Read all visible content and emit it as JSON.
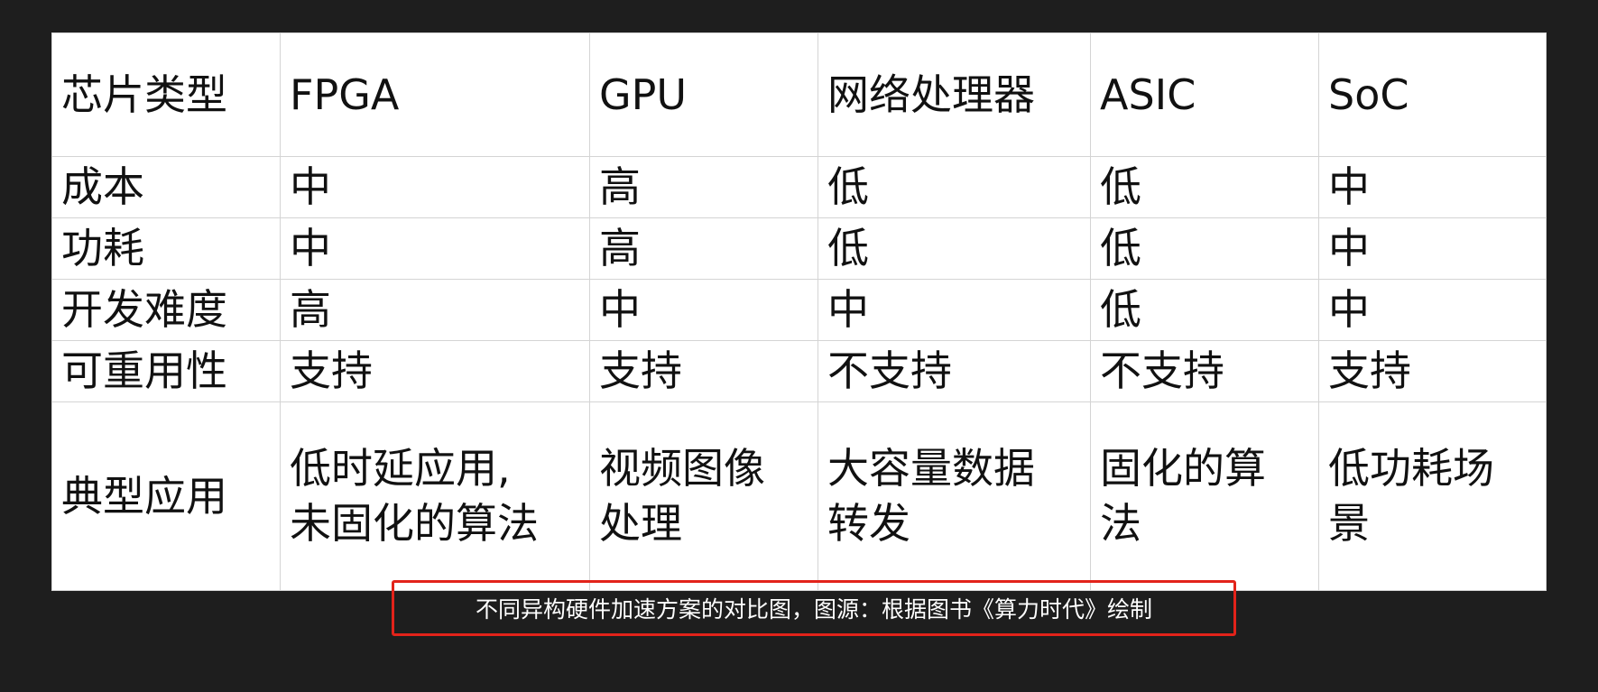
{
  "table": {
    "header": [
      "芯片类型",
      "FPGA",
      "GPU",
      "网络处理器",
      "ASIC",
      "SoC"
    ],
    "rows": [
      [
        "成本",
        "中",
        "高",
        "低",
        "低",
        "中"
      ],
      [
        "功耗",
        "中",
        "高",
        "低",
        "低",
        "中"
      ],
      [
        "开发难度",
        "高",
        "中",
        "中",
        "低",
        "中"
      ],
      [
        "可重用性",
        "支持",
        "支持",
        "不支持",
        "不支持",
        "支持"
      ]
    ],
    "apps_row": {
      "label": "典型应用",
      "cells": [
        [
          "低时延应用,",
          "未固化的算法"
        ],
        [
          "视频图像",
          "处理"
        ],
        [
          "大容量数据",
          "转发"
        ],
        [
          "固化的算",
          "法"
        ],
        [
          "低功耗场",
          "景"
        ]
      ]
    }
  },
  "caption": {
    "text": "不同异构硬件加速方案的对比图，图源：根据图书《算力时代》绘制"
  },
  "colors": {
    "background": "#1e1e1e",
    "table_bg": "#ffffff",
    "grid": "#d4d4d4",
    "highlight_box": "#e2231a",
    "caption_text": "#ffffff"
  }
}
